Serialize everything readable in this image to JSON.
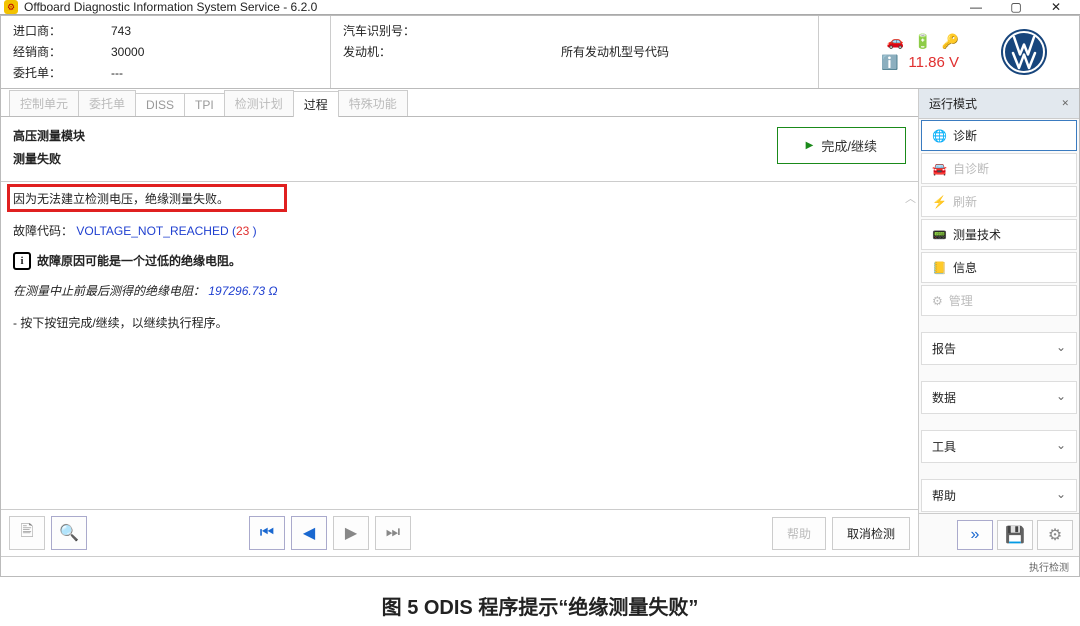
{
  "window": {
    "title": "Offboard Diagnostic Information System Service - 6.2.0",
    "min": "—",
    "max": "▢",
    "close": "✕"
  },
  "header": {
    "importer_label": "进口商：",
    "importer_value": "743",
    "dealer_label": "经销商：",
    "dealer_value": "30000",
    "order_label": "委托单：",
    "order_value": "---",
    "vin_label": "汽车识别号：",
    "vin_value": "",
    "engine_label": "发动机：",
    "engine_value": "所有发动机型号代码",
    "voltage": "11.86 V"
  },
  "tabs": {
    "t0": "控制单元",
    "t1": "委托单",
    "t2": "DISS",
    "t3": "TPI",
    "t4": "检测计划",
    "t5": "过程",
    "t6": "特殊功能"
  },
  "content": {
    "module_title": "高压测量模块",
    "measure_fail": "测量失败",
    "boxed_msg": "因为无法建立检测电压，绝缘测量失败。",
    "fault_label": "故障代码：",
    "fault_code_text": "VOLTAGE_NOT_REACHED (",
    "fault_code_num": "23",
    "fault_code_close": " )",
    "info_reason": "故障原因可能是一个过低的绝缘电阻。",
    "last_res_label": "在测量中止前最后测得的绝缘电阻：",
    "last_res_value": "197296.73 Ω",
    "press_continue": "- 按下按钮完成/继续，以继续执行程序。",
    "continue_btn": "完成/继续",
    "help_btn": "帮助",
    "cancel_btn": "取消检测"
  },
  "right": {
    "header": "运行模式",
    "diag": "诊断",
    "selfdiag": "自诊断",
    "flash": "刷新",
    "meastech": "测量技术",
    "info": "信息",
    "admin": "管理",
    "report": "报告",
    "data": "数据",
    "tools": "工具",
    "helpsec": "帮助"
  },
  "footer_status": "执行检测",
  "caption": "图 5  ODIS 程序提示“绝缘测量失败”"
}
